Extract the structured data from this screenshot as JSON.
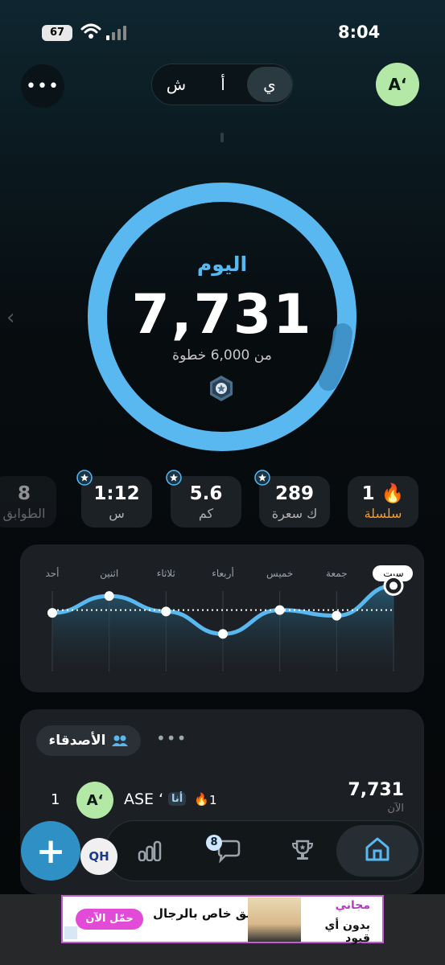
{
  "status_bar": {
    "time": "8:04",
    "battery": "67"
  },
  "header": {
    "more_label": "•••",
    "segments": [
      {
        "label": "ي",
        "active": true
      },
      {
        "label": "أ",
        "active": false
      },
      {
        "label": "ش",
        "active": false
      }
    ],
    "avatar_initials": "A‘"
  },
  "ring": {
    "label": "اليوم",
    "value": "7,731",
    "goal_text": "من 6,000 خطوة",
    "progress": 1.29
  },
  "stats": [
    {
      "value": "1",
      "label": "سلسلة",
      "icon": "fire-icon",
      "kind": "streak"
    },
    {
      "value": "289",
      "label": "ك سعرة"
    },
    {
      "value": "5.6",
      "label": "كم"
    },
    {
      "value": "1:12",
      "label": "س"
    },
    {
      "value": "8",
      "label": "الطوابق"
    }
  ],
  "chart_data": {
    "type": "line",
    "categories": [
      "أحد",
      "اثنين",
      "ثلاثاء",
      "أربعاء",
      "خميس",
      "جمعة",
      "سبت"
    ],
    "selected": "سبت",
    "values": [
      5800,
      7000,
      5900,
      4300,
      6000,
      5600,
      7731
    ],
    "goal": 6000
  },
  "friends": {
    "title": "الأصدقاء",
    "more_label": "•••",
    "rows": [
      {
        "rank": "1",
        "initials": "A‘",
        "name": "ASE ‘",
        "me_label": "أنا",
        "streak": "1",
        "steps": "7,731",
        "time": "الآن"
      }
    ]
  },
  "nav": {
    "fab_label": "+",
    "messages_badge": "8",
    "qh_label": "QH"
  },
  "ad": {
    "button": "حمّل الآن",
    "headline": "تطبيق خاص بالرجال",
    "free": "مجاني",
    "tagline": "بدون أي قيود"
  },
  "colors": {
    "accent": "#5ab8f0",
    "streak": "#f29a2e",
    "avatar": "#b3e8a6"
  }
}
